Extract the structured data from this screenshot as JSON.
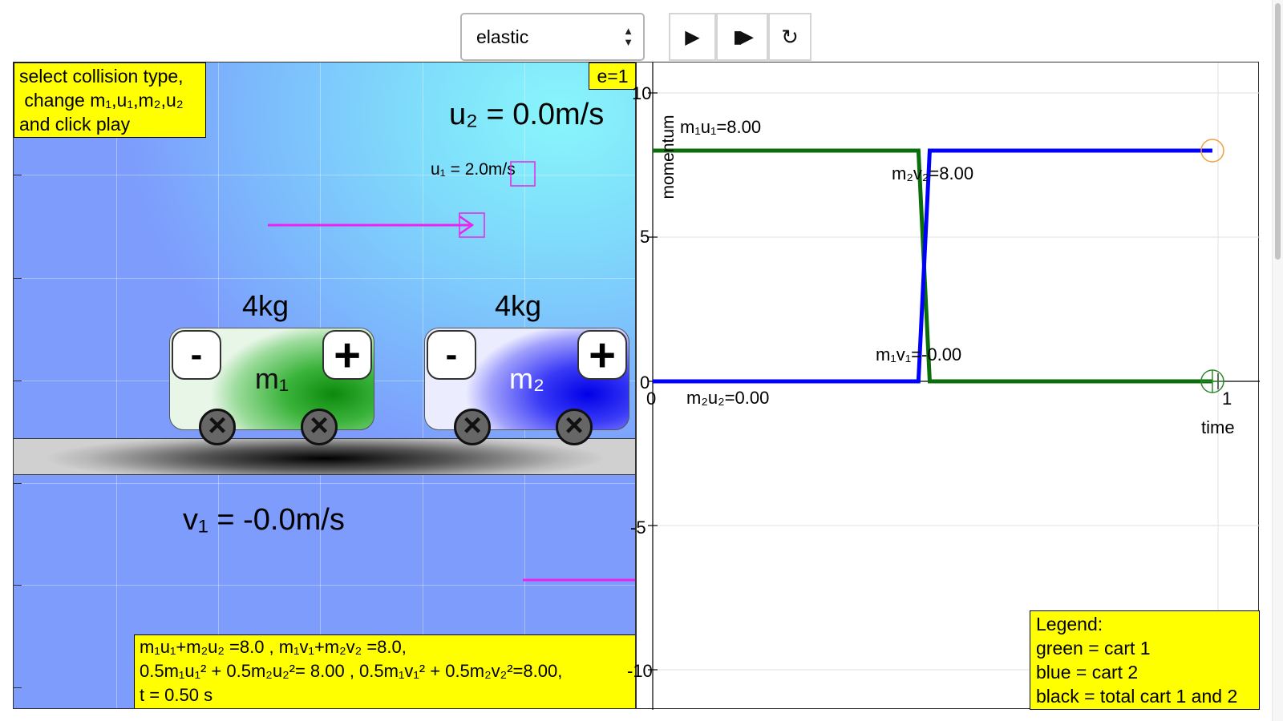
{
  "toolbar": {
    "collision_type": "elastic",
    "icons": {
      "play": "play-icon",
      "step": "step-icon",
      "reset": "reset-icon"
    },
    "play_glyph": "▶",
    "step_glyph": "▮▶",
    "reset_glyph": "↻"
  },
  "simulation": {
    "hint": [
      "select collision type,",
      " change m₁,u₁,m₂,u₂",
      "and click play"
    ],
    "e_coefficient": "e=1",
    "u2_text": "u₂ = 0.0m/s",
    "u1_text": "u₁ = 2.0m/s",
    "v1_text": "v₁ = -0.0m/s",
    "cart1": {
      "mass": "4kg",
      "label": "m₁",
      "minus": "-",
      "plus": "+",
      "color": "#0c8a0c"
    },
    "cart2": {
      "mass": "4kg",
      "label": "m₂",
      "minus": "-",
      "plus": "+",
      "color": "#0000e8"
    },
    "velocity_arrow_color": "#ee22ee",
    "equations": [
      "m₁u₁+m₂u₂ =8.0 , m₁v₁+m₂v₂ =8.0,",
      "0.5m₁u₁² + 0.5m₂u₂²= 8.00 , 0.5m₁v₁² + 0.5m₂v₂²=8.00,",
      "t = 0.50 s"
    ]
  },
  "graph": {
    "y_title": "momentum",
    "x_title": "time",
    "y_ticks": [
      "10",
      "5",
      "0",
      "-5",
      "-10"
    ],
    "x_ticks": [
      "0",
      "1"
    ],
    "labels": {
      "m1u1": "m₁u₁=8.00",
      "m2v2": "m₂v₂=8.00",
      "m1v1": "m₁v₁=-0.00",
      "m2u2": "m₂u₂=0.00"
    },
    "legend": [
      "Legend:",
      "green = cart 1",
      "blue = cart 2",
      "black = total cart 1 and 2"
    ],
    "series_colors": {
      "cart1": "#0a6e0a",
      "cart2": "#0000ff"
    },
    "chart_data": {
      "type": "line",
      "xlabel": "time",
      "ylabel": "momentum",
      "xlim": [
        0,
        1
      ],
      "ylim": [
        -10,
        10
      ],
      "series": [
        {
          "name": "cart 1",
          "x": [
            0,
            0.47,
            0.49,
            0.99
          ],
          "values": [
            8,
            8,
            0,
            0
          ]
        },
        {
          "name": "cart 2",
          "x": [
            0,
            0.47,
            0.49,
            0.99
          ],
          "values": [
            0,
            0,
            8,
            8
          ]
        }
      ]
    }
  }
}
